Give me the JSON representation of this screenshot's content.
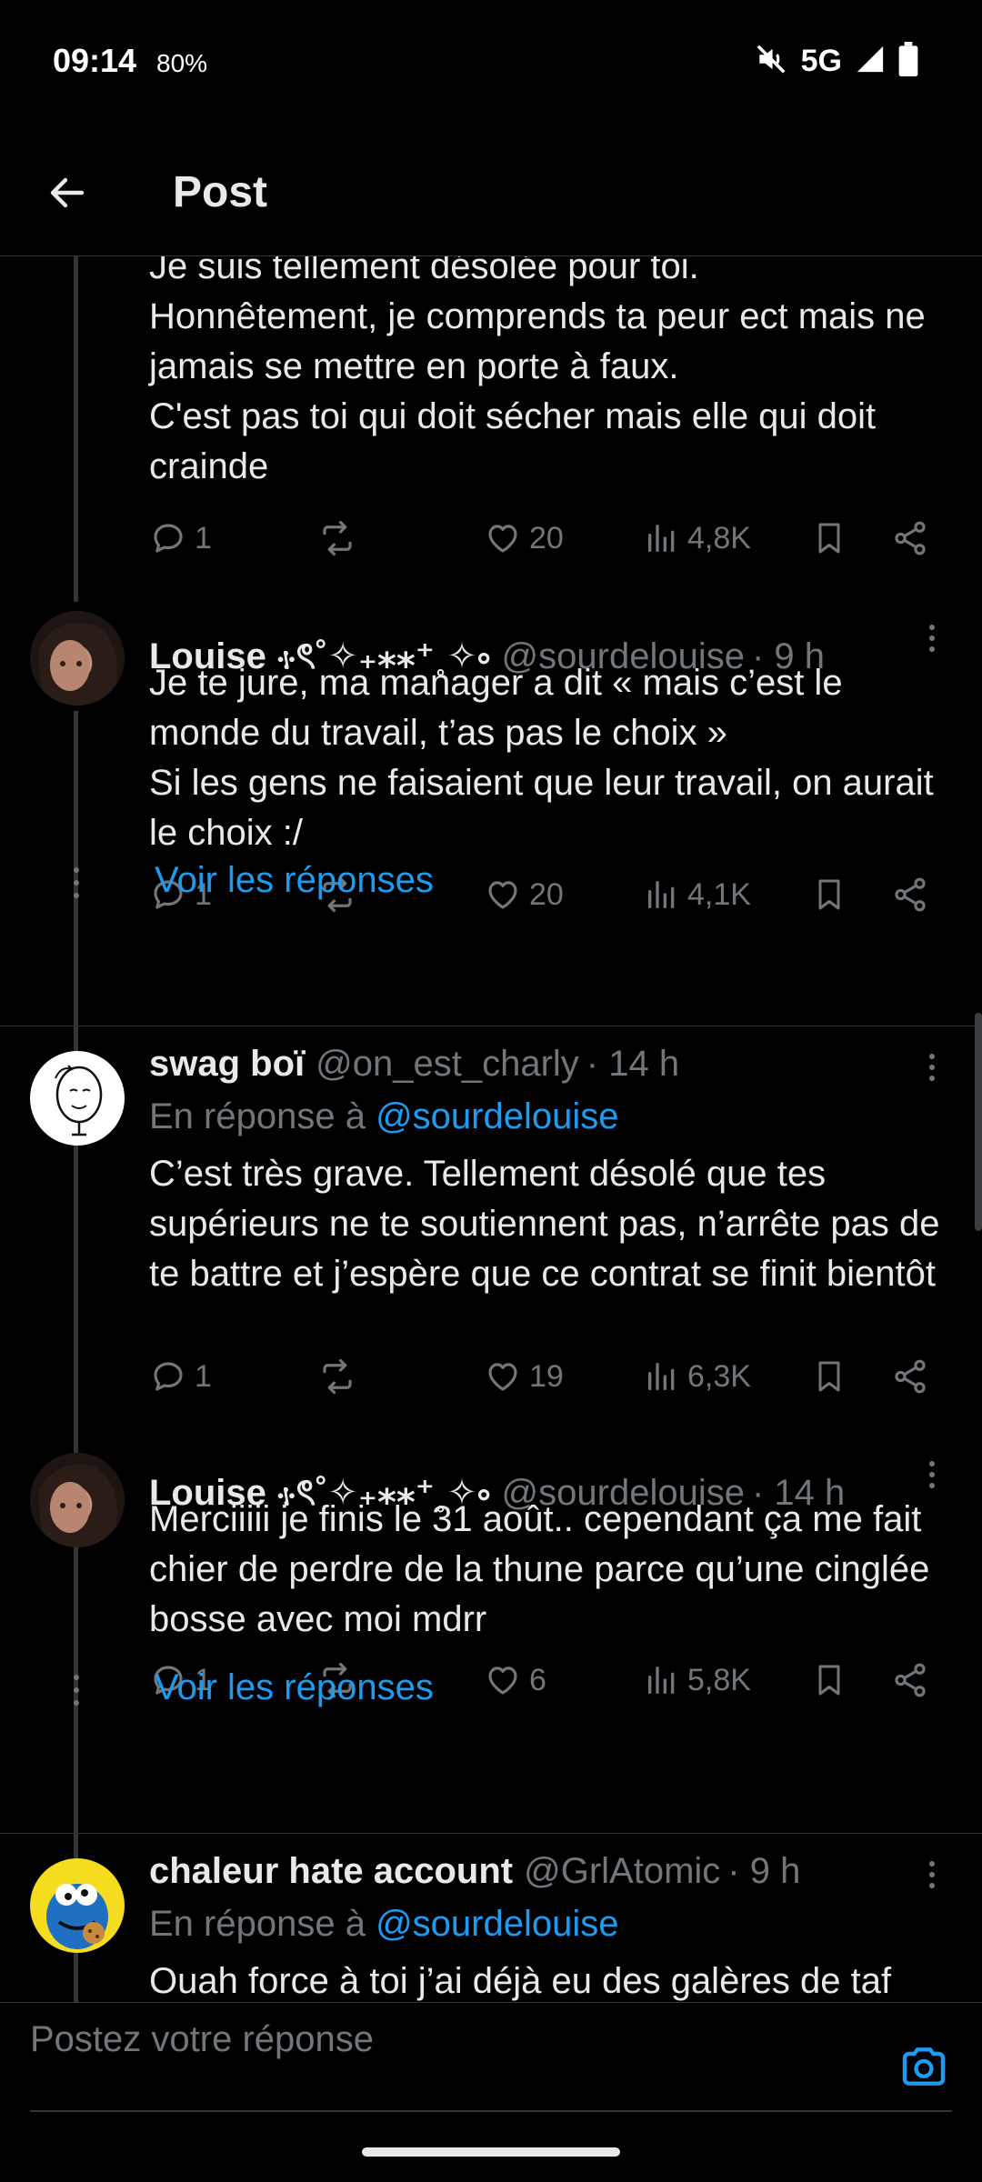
{
  "status": {
    "time": "09:14",
    "battery": "80%",
    "network": "5G",
    "icons": [
      "mute-icon",
      "signal-icon",
      "battery-icon"
    ]
  },
  "header": {
    "title": "Post"
  },
  "colors": {
    "accent": "#1d9bf0",
    "muted": "#71767b",
    "background": "#000000",
    "text": "#e7e9ea"
  },
  "tweets": [
    {
      "text": "Je suis tellement désolée pour toi.\nHonnêtement, je comprends ta peur ect mais ne jamais se mettre en porte à faux.\nC'est pas toi qui doit sécher mais elle qui doit crainde",
      "replies": "1",
      "likes": "20",
      "views": "4,8K"
    },
    {
      "name": "Louise ⳾ৎ˚✧₊⁎⁎⁺˳✧༚",
      "handle": "@sourdelouise",
      "time": "· 9 h",
      "text": "Je te jure, ma manager a dit « mais c’est le monde du travail, t’as pas le choix »\nSi les gens ne faisaient que leur travail, on aurait le choix :/",
      "replies": "1",
      "likes": "20",
      "views": "4,1K",
      "show_replies": "Voir les réponses"
    },
    {
      "name": "swag boï",
      "handle": "@on_est_charly",
      "time": "· 14 h",
      "reply_prefix": "En réponse à",
      "reply_to": "@sourdelouise",
      "text": "C’est très grave. Tellement désolé que tes supérieurs ne te soutiennent pas, n’arrête pas de te battre et j’espère que ce contrat se finit bientôt",
      "replies": "1",
      "likes": "19",
      "views": "6,3K"
    },
    {
      "name": "Louise ⳾ৎ˚✧₊⁎⁎⁺˳✧༚",
      "handle": "@sourdelouise",
      "time": "· 14 h",
      "text": "Merciiiii je finis le 31 août.. cependant ça me fait chier de perdre de la thune parce qu’une cinglée bosse avec moi mdrr",
      "replies": "1",
      "likes": "6",
      "views": "5,8K",
      "show_replies": "Voir les réponses"
    },
    {
      "name": "chaleur hate account",
      "handle": "@GrlAtomic",
      "time": "· 9 h",
      "reply_prefix": "En réponse à",
      "reply_to": "@sourdelouise",
      "text": "Ouah force à toi j’ai déjà eu des galères de taf"
    }
  ],
  "reply_bar": {
    "placeholder": "Postez votre réponse"
  }
}
